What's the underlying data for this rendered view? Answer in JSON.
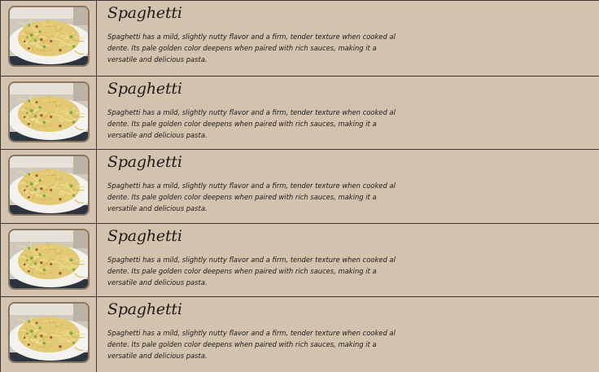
{
  "items": [
    {
      "title": "Spaghetti",
      "description": "Spaghetti has a mild, slightly nutty flavor and a firm, tender texture when cooked al dente. Its pale golden color deepens when paired with rich sauces, making it a versatile and delicious pasta."
    },
    {
      "title": "Spaghetti",
      "description": "Spaghetti has a mild, slightly nutty flavor and a firm, tender texture when cooked al dente. Its pale golden color deepens when paired with rich sauces, making it a versatile and delicious pasta."
    },
    {
      "title": "Spaghetti",
      "description": "Spaghetti has a mild, slightly nutty flavor and a firm, tender texture when cooked al dente. Its pale golden color deepens when paired with rich sauces, making it a versatile and delicious pasta."
    },
    {
      "title": "Spaghetti",
      "description": "Spaghetti has a mild, slightly nutty flavor and a firm, tender texture when cooked al dente. Its pale golden color deepens when paired with rich sauces, making it a versatile and delicious pasta."
    },
    {
      "title": "Spaghetti",
      "description": "Spaghetti has a mild, slightly nutty flavor and a firm, tender texture when cooked al dente. Its pale golden color deepens when paired with rich sauces, making it a versatile and delicious pasta."
    }
  ],
  "colors": {
    "background": "#d2c2ae",
    "border": "#3a3530",
    "thumb_frame": "#8a7560",
    "text": "#1e1b18"
  },
  "icons": {
    "thumbnail": "spaghetti-photo"
  }
}
